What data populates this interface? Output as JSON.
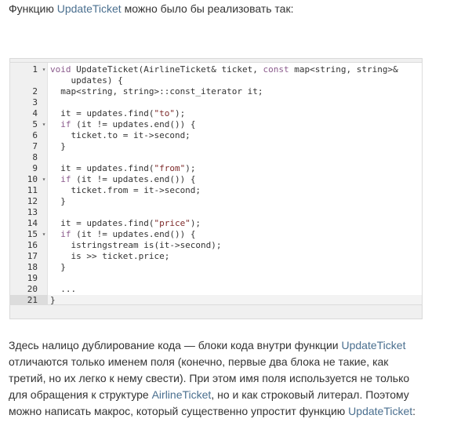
{
  "intro": {
    "before": "Функцию ",
    "func": "UpdateTicket",
    "after": " можно было бы реализовать так:"
  },
  "code_lines": [
    {
      "n": "1",
      "fold": "▾",
      "parts": [
        [
          "kw",
          "void"
        ],
        [
          "t",
          " UpdateTicket(AirlineTicket& ticket, "
        ],
        [
          "kw",
          "const"
        ],
        [
          "t",
          " map<string, string>&"
        ]
      ]
    },
    {
      "n": "",
      "fold": "",
      "parts": [
        [
          "t",
          "    updates) {"
        ]
      ]
    },
    {
      "n": "2",
      "fold": "",
      "parts": [
        [
          "t",
          "  map<string, string>::const_iterator it;"
        ]
      ]
    },
    {
      "n": "3",
      "fold": "",
      "parts": [
        [
          "t",
          ""
        ]
      ]
    },
    {
      "n": "4",
      "fold": "",
      "parts": [
        [
          "t",
          "  it = updates.find("
        ],
        [
          "str",
          "\"to\""
        ],
        [
          "t",
          ");"
        ]
      ]
    },
    {
      "n": "5",
      "fold": "▾",
      "parts": [
        [
          "t",
          "  "
        ],
        [
          "kw",
          "if"
        ],
        [
          "t",
          " (it != updates.end()) {"
        ]
      ]
    },
    {
      "n": "6",
      "fold": "",
      "parts": [
        [
          "t",
          "    ticket.to = it->second;"
        ]
      ]
    },
    {
      "n": "7",
      "fold": "",
      "parts": [
        [
          "t",
          "  }"
        ]
      ]
    },
    {
      "n": "8",
      "fold": "",
      "parts": [
        [
          "t",
          ""
        ]
      ]
    },
    {
      "n": "9",
      "fold": "",
      "parts": [
        [
          "t",
          "  it = updates.find("
        ],
        [
          "str",
          "\"from\""
        ],
        [
          "t",
          ");"
        ]
      ]
    },
    {
      "n": "10",
      "fold": "▾",
      "parts": [
        [
          "t",
          "  "
        ],
        [
          "kw",
          "if"
        ],
        [
          "t",
          " (it != updates.end()) {"
        ]
      ]
    },
    {
      "n": "11",
      "fold": "",
      "parts": [
        [
          "t",
          "    ticket.from = it->second;"
        ]
      ]
    },
    {
      "n": "12",
      "fold": "",
      "parts": [
        [
          "t",
          "  }"
        ]
      ]
    },
    {
      "n": "13",
      "fold": "",
      "parts": [
        [
          "t",
          ""
        ]
      ]
    },
    {
      "n": "14",
      "fold": "",
      "parts": [
        [
          "t",
          "  it = updates.find("
        ],
        [
          "str",
          "\"price\""
        ],
        [
          "t",
          ");"
        ]
      ]
    },
    {
      "n": "15",
      "fold": "▾",
      "parts": [
        [
          "t",
          "  "
        ],
        [
          "kw",
          "if"
        ],
        [
          "t",
          " (it != updates.end()) {"
        ]
      ]
    },
    {
      "n": "16",
      "fold": "",
      "parts": [
        [
          "t",
          "    istringstream is(it->second);"
        ]
      ]
    },
    {
      "n": "17",
      "fold": "",
      "parts": [
        [
          "t",
          "    is >> ticket.price;"
        ]
      ]
    },
    {
      "n": "18",
      "fold": "",
      "parts": [
        [
          "t",
          "  }"
        ]
      ]
    },
    {
      "n": "19",
      "fold": "",
      "parts": [
        [
          "t",
          ""
        ]
      ]
    },
    {
      "n": "20",
      "fold": "",
      "parts": [
        [
          "t",
          "  ..."
        ]
      ]
    },
    {
      "n": "21",
      "fold": "",
      "parts": [
        [
          "t",
          "}"
        ]
      ],
      "active": true
    }
  ],
  "outro": [
    [
      "t",
      "Здесь налицо дублирование кода — блоки кода внутри функции "
    ],
    [
      "hl",
      "UpdateTicket"
    ],
    [
      "br",
      ""
    ],
    [
      "t",
      "отличаются только именем поля (конечно, первые два блока не такие, как"
    ],
    [
      "br",
      ""
    ],
    [
      "t",
      "третий, но их легко к нему свести). При этом имя поля используется не только"
    ],
    [
      "br",
      ""
    ],
    [
      "t",
      "для обращения к структуре "
    ],
    [
      "hl",
      "AirlineTicket"
    ],
    [
      "t",
      ", но и как строковый литерал. Поэтому"
    ],
    [
      "br",
      ""
    ],
    [
      "t",
      "можно написать макрос, который существенно упростит функцию "
    ],
    [
      "hl",
      "UpdateTicket"
    ],
    [
      "t",
      ":"
    ]
  ],
  "colors": {
    "highlight": "#4a6f8f",
    "keyword": "#8a5a8c",
    "string": "#7d2a2a"
  }
}
